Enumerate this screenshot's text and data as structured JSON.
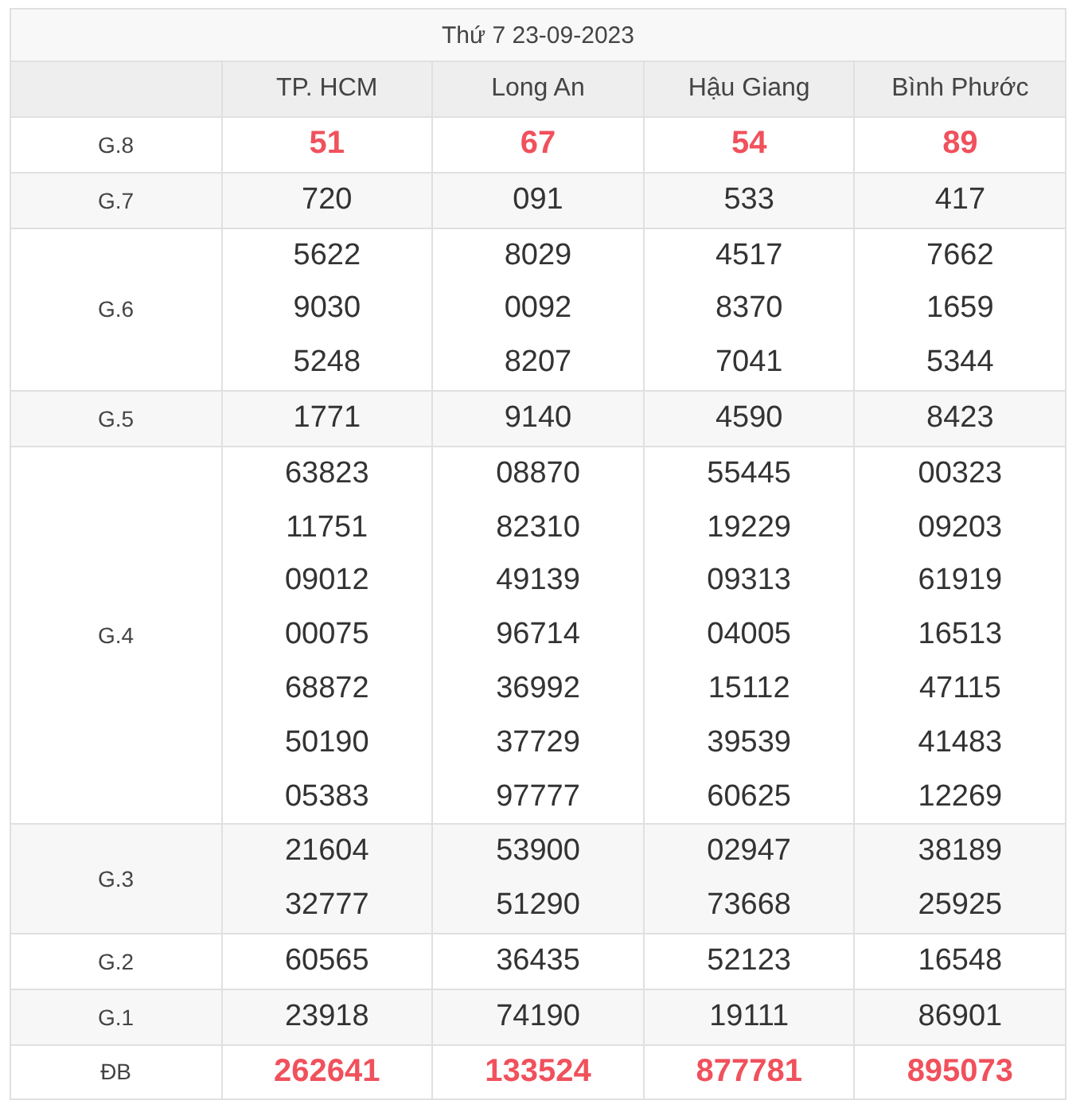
{
  "title": "Thứ 7 23-09-2023",
  "columns": [
    "TP. HCM",
    "Long An",
    "Hậu Giang",
    "Bình Phước"
  ],
  "prizes": [
    {
      "label": "G.8",
      "highlight": true,
      "values": [
        [
          "51"
        ],
        [
          "67"
        ],
        [
          "54"
        ],
        [
          "89"
        ]
      ]
    },
    {
      "label": "G.7",
      "highlight": false,
      "values": [
        [
          "720"
        ],
        [
          "091"
        ],
        [
          "533"
        ],
        [
          "417"
        ]
      ]
    },
    {
      "label": "G.6",
      "highlight": false,
      "values": [
        [
          "5622",
          "9030",
          "5248"
        ],
        [
          "8029",
          "0092",
          "8207"
        ],
        [
          "4517",
          "8370",
          "7041"
        ],
        [
          "7662",
          "1659",
          "5344"
        ]
      ]
    },
    {
      "label": "G.5",
      "highlight": false,
      "values": [
        [
          "1771"
        ],
        [
          "9140"
        ],
        [
          "4590"
        ],
        [
          "8423"
        ]
      ]
    },
    {
      "label": "G.4",
      "highlight": false,
      "values": [
        [
          "63823",
          "11751",
          "09012",
          "00075",
          "68872",
          "50190",
          "05383"
        ],
        [
          "08870",
          "82310",
          "49139",
          "96714",
          "36992",
          "37729",
          "97777"
        ],
        [
          "55445",
          "19229",
          "09313",
          "04005",
          "15112",
          "39539",
          "60625"
        ],
        [
          "00323",
          "09203",
          "61919",
          "16513",
          "47115",
          "41483",
          "12269"
        ]
      ]
    },
    {
      "label": "G.3",
      "highlight": false,
      "values": [
        [
          "21604",
          "32777"
        ],
        [
          "53900",
          "51290"
        ],
        [
          "02947",
          "73668"
        ],
        [
          "38189",
          "25925"
        ]
      ]
    },
    {
      "label": "G.2",
      "highlight": false,
      "values": [
        [
          "60565"
        ],
        [
          "36435"
        ],
        [
          "52123"
        ],
        [
          "16548"
        ]
      ]
    },
    {
      "label": "G.1",
      "highlight": false,
      "values": [
        [
          "23918"
        ],
        [
          "74190"
        ],
        [
          "19111"
        ],
        [
          "86901"
        ]
      ]
    },
    {
      "label": "ĐB",
      "highlight": true,
      "values": [
        [
          "262641"
        ],
        [
          "133524"
        ],
        [
          "877781"
        ],
        [
          "895073"
        ]
      ]
    }
  ]
}
